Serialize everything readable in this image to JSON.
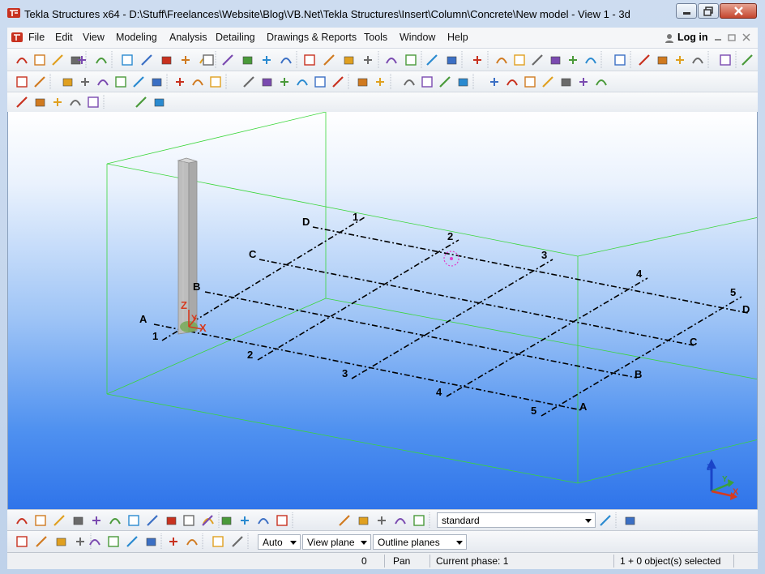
{
  "window": {
    "title": "Tekla Structures x64 - D:\\Stuff\\Freelances\\Website\\Blog\\VB.Net\\Tekla Structures\\Insert\\Column\\Concrete\\New model  - View 1 - 3d",
    "buttons": {
      "minimize": "minimize",
      "maximize": "maximize",
      "close": "close"
    }
  },
  "menu": {
    "items": [
      "File",
      "Edit",
      "View",
      "Modeling",
      "Analysis",
      "Detailing",
      "Drawings & Reports",
      "Tools",
      "Window",
      "Help"
    ],
    "login": "Log in"
  },
  "viewport": {
    "grid_labels": {
      "letters": [
        "A",
        "B",
        "C",
        "D"
      ],
      "numbers": [
        "1",
        "2",
        "3",
        "4",
        "5"
      ]
    },
    "axes": {
      "z": "Z",
      "y": "Y",
      "x": "X"
    }
  },
  "bottom_toolbar": {
    "filter_select": "standard",
    "snap_depth": "Auto",
    "work_plane": "View plane",
    "outline": "Outline planes"
  },
  "status": {
    "count": "0",
    "mode": "Pan",
    "phase": "Current phase: 1",
    "selection": "1 + 0 object(s) selected"
  },
  "colors": {
    "accent_red": "#d63a1f",
    "viewport_bottom": "#2f74ea",
    "work_area_box": "#3ad63a"
  }
}
